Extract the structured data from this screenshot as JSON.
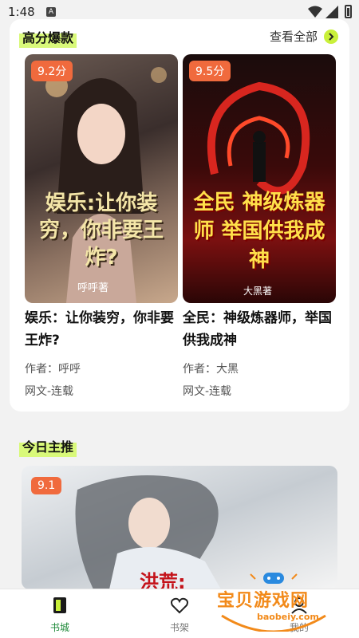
{
  "status_bar": {
    "time": "1:48",
    "notif_letter": "A"
  },
  "section_hot": {
    "title": "高分爆款",
    "see_all": "查看全部",
    "books": [
      {
        "score": "9.2分",
        "title": "娱乐：让你装穷，你非要王炸?",
        "author": "作者：呼呼",
        "category": "网文-连载",
        "cover_caption": "娱乐:让你装穷，你非要王炸?",
        "cover_author": "呼呼著"
      },
      {
        "score": "9.5分",
        "title": "全民：神级炼器师，举国供我成神",
        "author": "作者：大黑",
        "category": "网文-连载",
        "cover_caption": "全民 神级炼器师 举国供我成神",
        "cover_author": "大黑著"
      }
    ]
  },
  "section_today": {
    "title": "今日主推",
    "score": "9.1",
    "cover_caption": "洪荒:"
  },
  "tabbar": {
    "items": [
      {
        "label": "书城"
      },
      {
        "label": "书架"
      },
      {
        "label": "我的"
      }
    ]
  },
  "watermark": {
    "text": "宝贝游戏网",
    "url": "baobeiy.com"
  },
  "colors": {
    "accent_green": "#c9f03a",
    "score_orange": "#f06a3d",
    "active_tab": "#1f8a3a"
  }
}
